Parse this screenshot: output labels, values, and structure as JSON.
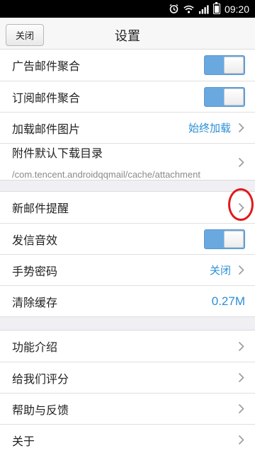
{
  "status_bar": {
    "time": "09:20",
    "icons": [
      "alarm-icon",
      "wifi-icon",
      "signal-icon",
      "battery-icon"
    ]
  },
  "header": {
    "close_label": "关闭",
    "title": "设置"
  },
  "group1": [
    {
      "label": "广告邮件聚合",
      "type": "toggle",
      "on": true
    },
    {
      "label": "订阅邮件聚合",
      "type": "toggle",
      "on": true
    },
    {
      "label": "加载邮件图片",
      "type": "value",
      "value": "始终加载"
    },
    {
      "label": "附件默认下载目录",
      "type": "path",
      "sub": "/com.tencent.androidqqmail/cache/attachment"
    }
  ],
  "group2": [
    {
      "label": "新邮件提醒",
      "type": "link"
    },
    {
      "label": "发信音效",
      "type": "toggle",
      "on": true
    },
    {
      "label": "手势密码",
      "type": "value",
      "value": "关闭"
    },
    {
      "label": "清除缓存",
      "type": "value",
      "value": "0.27M"
    }
  ],
  "group3": [
    {
      "label": "功能介绍",
      "type": "link"
    },
    {
      "label": "给我们评分",
      "type": "link"
    },
    {
      "label": "帮助与反馈",
      "type": "link"
    },
    {
      "label": "关于",
      "type": "link"
    }
  ],
  "colors": {
    "accent": "#2b8fd6",
    "toggle_on": "#6aa8e0",
    "annotation": "#e01919"
  }
}
